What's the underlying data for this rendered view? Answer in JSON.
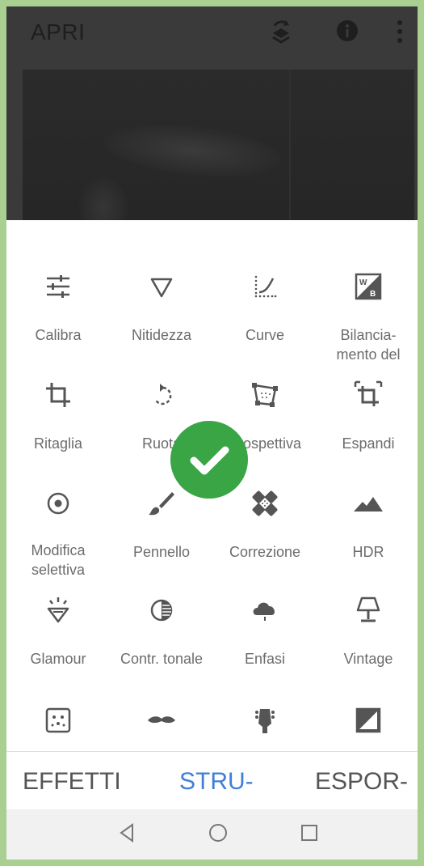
{
  "app": {
    "title": "APRI"
  },
  "header": {
    "icons": [
      "history-layers-icon",
      "info-icon",
      "more-vert-icon"
    ]
  },
  "tools": [
    {
      "label": "Calibra",
      "icon": "tune-icon"
    },
    {
      "label": "Nitidezza",
      "icon": "triangle-outline-icon"
    },
    {
      "label": "Curve",
      "icon": "curve-icon"
    },
    {
      "label": "Bilancia-\nmento del",
      "icon": "white-balance-icon"
    },
    {
      "label": "Ritaglia",
      "icon": "crop-icon"
    },
    {
      "label": "Ruota",
      "icon": "rotate-icon"
    },
    {
      "label": "Prospettiva",
      "icon": "perspective-icon"
    },
    {
      "label": "Espandi",
      "icon": "expand-icon"
    },
    {
      "label": "Modifica\nselettiva",
      "icon": "selective-target-icon"
    },
    {
      "label": "Pennello",
      "icon": "brush-icon"
    },
    {
      "label": "Correzione",
      "icon": "healing-bandage-icon"
    },
    {
      "label": "HDR",
      "icon": "mountains-icon"
    },
    {
      "label": "Glamour",
      "icon": "diamond-sparkle-icon"
    },
    {
      "label": "Contr. tonale",
      "icon": "tonal-contrast-icon"
    },
    {
      "label": "Enfasi",
      "icon": "cloud-rain-icon"
    },
    {
      "label": "Vintage",
      "icon": "lamp-icon"
    },
    {
      "label": "",
      "icon": "grain-dice-icon"
    },
    {
      "label": "",
      "icon": "mustache-icon"
    },
    {
      "label": "",
      "icon": "guitar-head-icon"
    },
    {
      "label": "",
      "icon": "black-white-icon"
    }
  ],
  "tabs": [
    {
      "label": "EFFETTI"
    },
    {
      "label": "STRU-"
    },
    {
      "label": "ESPOR-"
    }
  ],
  "active_tab": "STRU-",
  "colors": {
    "accent": "#3f7fd6",
    "icon": "#555555",
    "label": "#6c6c6c",
    "check": "#3aa545"
  },
  "navigation": {
    "buttons": [
      "back-triangle-icon",
      "home-circle-icon",
      "recents-square-icon"
    ]
  }
}
